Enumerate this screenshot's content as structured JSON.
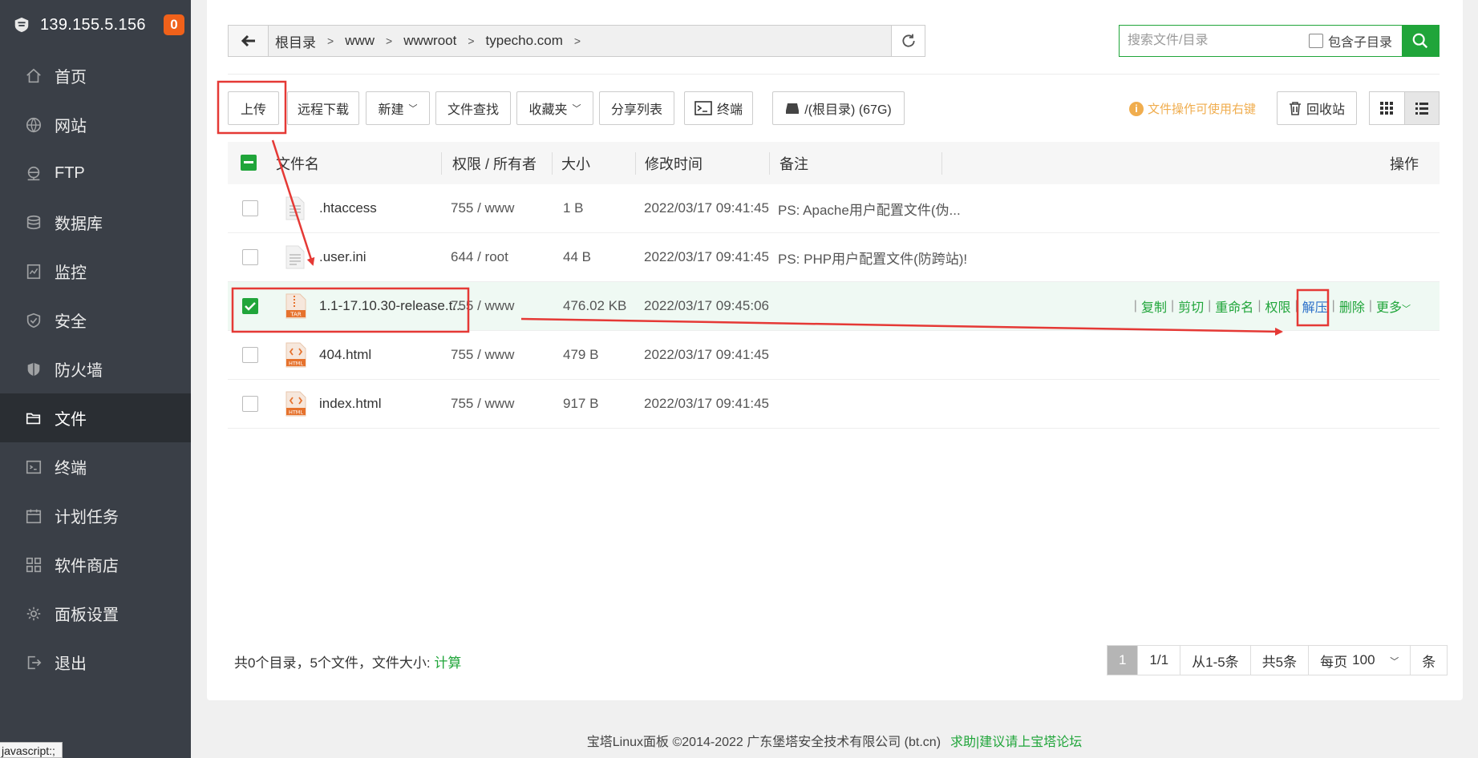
{
  "sidebar": {
    "ip": "139.155.5.156",
    "badge": "0",
    "items": [
      {
        "label": "首页",
        "icon": "home-icon"
      },
      {
        "label": "网站",
        "icon": "globe-icon"
      },
      {
        "label": "FTP",
        "icon": "ftp-icon"
      },
      {
        "label": "数据库",
        "icon": "database-icon"
      },
      {
        "label": "监控",
        "icon": "monitor-icon"
      },
      {
        "label": "安全",
        "icon": "shield-icon"
      },
      {
        "label": "防火墙",
        "icon": "firewall-icon"
      },
      {
        "label": "文件",
        "icon": "folder-icon",
        "active": true
      },
      {
        "label": "终端",
        "icon": "terminal-icon"
      },
      {
        "label": "计划任务",
        "icon": "calendar-icon"
      },
      {
        "label": "软件商店",
        "icon": "apps-icon"
      },
      {
        "label": "面板设置",
        "icon": "gear-icon"
      },
      {
        "label": "退出",
        "icon": "logout-icon"
      }
    ]
  },
  "path": {
    "crumbs": [
      "根目录",
      "www",
      "wwwroot",
      "typecho.com"
    ]
  },
  "search": {
    "placeholder": "搜索文件/目录",
    "include_sub_label": "包含子目录"
  },
  "toolbar": {
    "upload": "上传",
    "remote_download": "远程下载",
    "new": "新建",
    "find": "文件查找",
    "favorites": "收藏夹",
    "share_list": "分享列表",
    "terminal": "终端",
    "disk": "/(根目录) (67G)",
    "tip": "文件操作可使用右键",
    "recycle": "回收站"
  },
  "table": {
    "headers": {
      "name": "文件名",
      "perm": "权限 / 所有者",
      "size": "大小",
      "mtime": "修改时间",
      "note": "备注",
      "ops": "操作"
    },
    "rows": [
      {
        "name": ".htaccess",
        "perm": "755 / www",
        "size": "1 B",
        "mtime": "2022/03/17 09:41:45",
        "note": "PS: Apache用户配置文件(伪...",
        "type": "text",
        "checked": false
      },
      {
        "name": ".user.ini",
        "perm": "644 / root",
        "size": "44 B",
        "mtime": "2022/03/17 09:41:45",
        "note": "PS: PHP用户配置文件(防跨站)!",
        "type": "text",
        "checked": false
      },
      {
        "name": "1.1-17.10.30-release.t...",
        "perm": "755 / www",
        "size": "476.02 KB",
        "mtime": "2022/03/17 09:45:06",
        "note": "",
        "type": "tar",
        "checked": true
      },
      {
        "name": "404.html",
        "perm": "755 / www",
        "size": "479 B",
        "mtime": "2022/03/17 09:41:45",
        "note": "",
        "type": "html",
        "checked": false
      },
      {
        "name": "index.html",
        "perm": "755 / www",
        "size": "917 B",
        "mtime": "2022/03/17 09:41:45",
        "note": "",
        "type": "html",
        "checked": false
      }
    ],
    "row_ops": [
      "复制",
      "剪切",
      "重命名",
      "权限",
      "解压",
      "删除",
      "更多"
    ]
  },
  "footer": {
    "summary": "共0个目录，5个文件，文件大小: ",
    "calc": "计算",
    "pager": {
      "current": "1",
      "pages": "1/1",
      "range": "从1-5条",
      "total": "共5条",
      "per_page_label": "每页",
      "per_page_value": "100",
      "per_page_suffix": "条"
    },
    "copyright": "宝塔Linux面板 ©2014-2022 广东堡塔安全技术有限公司 (bt.cn)",
    "forum_link": "求助|建议请上宝塔论坛",
    "status_tip": "javascript:;"
  },
  "colors": {
    "accent": "#20a53a",
    "sidebar_bg": "#3a3f47",
    "badge": "#f0611a",
    "annotation": "#e53935",
    "tip": "#f0ad4e"
  }
}
